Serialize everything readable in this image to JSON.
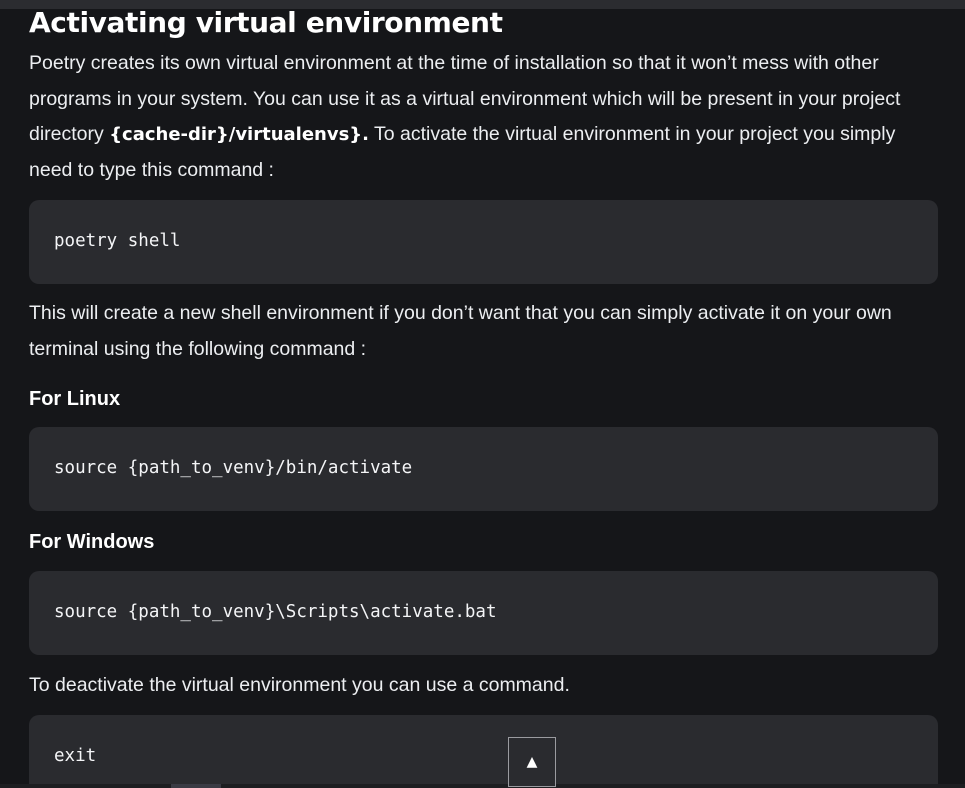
{
  "article": {
    "title": "Activating virtual environment",
    "intro": {
      "text_before": "Poetry creates its own virtual environment at the time of installation so that it won’t mess with other programs in your system. You can use it as a virtual environment which will be present in your project directory ",
      "strong": "{cache-dir}/virtualenvs}.",
      "text_after": " To activate the virtual environment in your project you simply need to type this command :"
    },
    "code_shell": "poetry shell",
    "shell_note": "This will create a new shell environment if you don’t want that you can simply activate it on your own terminal using the following command :",
    "linux_heading": "For Linux",
    "code_linux": "source {path_to_venv}/bin/activate",
    "windows_heading": "For Windows",
    "code_windows": "source {path_to_venv}\\Scripts\\activate.bat",
    "deactivate_note": "To deactivate the virtual environment you can use a command.",
    "code_exit": "exit"
  },
  "scroll_top": {
    "label": "▲"
  }
}
